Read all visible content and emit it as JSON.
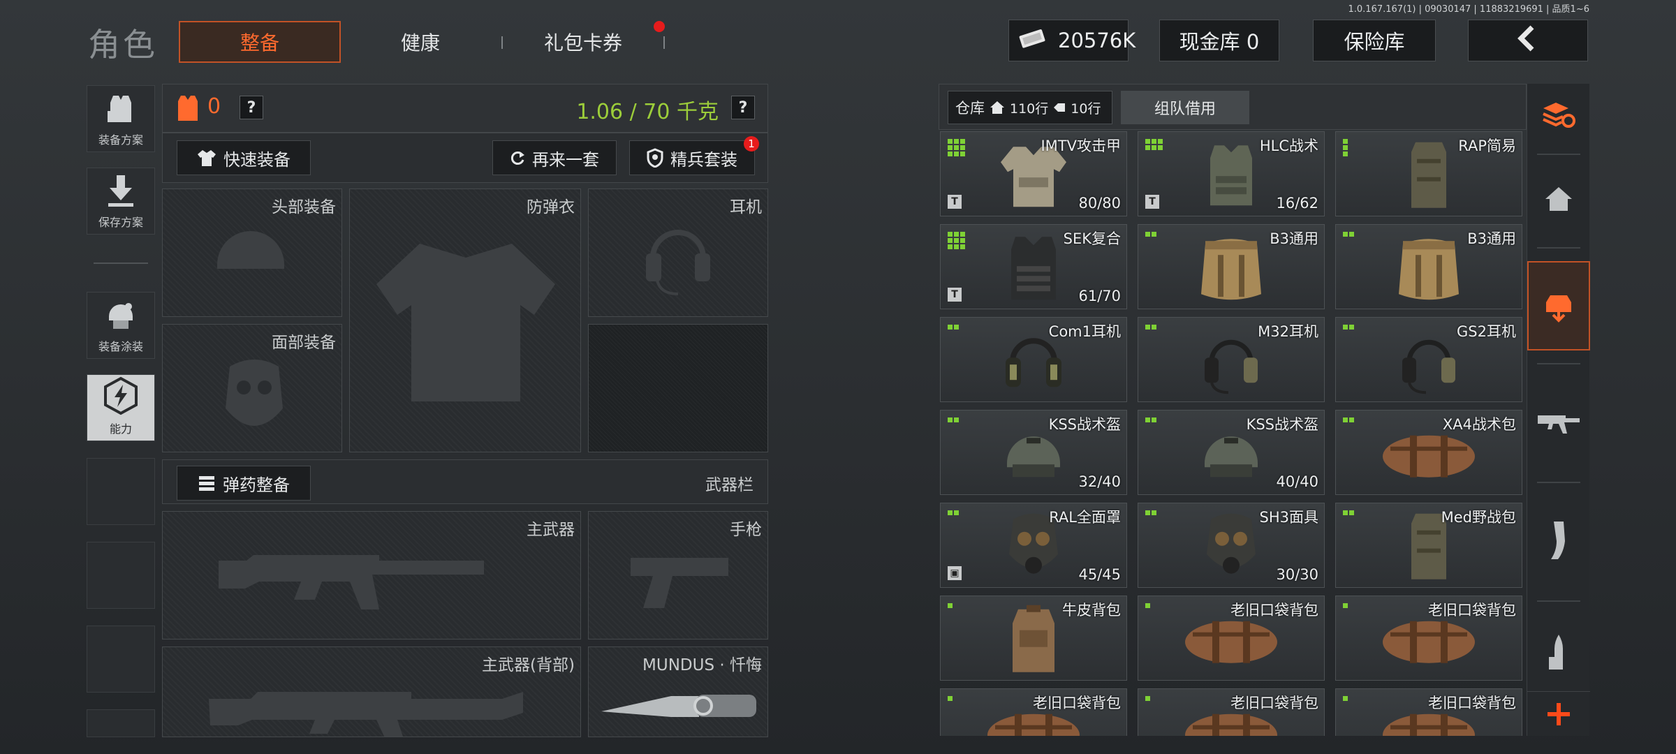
{
  "version": "1.0.167.167(1) | 09030147 | 11883219691 | 品质1~6",
  "header": {
    "title": "角色",
    "tabs": [
      {
        "label": "整备",
        "active": true
      },
      {
        "label": "健康",
        "active": false
      },
      {
        "label": "礼包卡券",
        "active": false,
        "has_badge": true
      }
    ],
    "money": "20576K",
    "cash_vault": "现金库 0",
    "safe_vault": "保险库"
  },
  "left_nav": [
    {
      "label": "装备方案",
      "icon": "vest-icon"
    },
    {
      "label": "保存方案",
      "icon": "download-icon"
    },
    {
      "label": "装备涂装",
      "icon": "helmet-paint-icon"
    },
    {
      "label": "能力",
      "icon": "lightning-icon",
      "active": true
    }
  ],
  "loadout": {
    "armor_count": "0",
    "weight": "1.06 / 70 千克",
    "quick_equip": "快速装备",
    "again": "再来一套",
    "elite_set": "精兵套装",
    "elite_badge": "1",
    "slots": {
      "head": "头部装备",
      "body": "防弹衣",
      "ear": "耳机",
      "face": "面部装备"
    },
    "ammo_btn": "弹药整备",
    "weapon_bar": "武器栏",
    "weapons": {
      "primary": "主武器",
      "pistol": "手枪",
      "primary_back": "主武器(背部)",
      "melee": "MUNDUS · 忏悔"
    }
  },
  "storage": {
    "tab_label": "仓库",
    "rows_home": "110行",
    "rows_tag": "10行",
    "team_borrow": "组队借用",
    "items": [
      {
        "name": "IMTV攻击甲",
        "count": "80/80",
        "dots": 9,
        "icon": "vest-armor-icon",
        "corner": "T"
      },
      {
        "name": "HLC战术",
        "count": "16/62",
        "dots": 6,
        "icon": "plate-carrier-icon",
        "corner": "T"
      },
      {
        "name": "RAP简易",
        "count": "",
        "dots": 3,
        "icon": "pouch-icon",
        "corner": ""
      },
      {
        "name": "SEK复合",
        "count": "61/70",
        "dots": 9,
        "icon": "tactical-vest-icon",
        "corner": "T"
      },
      {
        "name": "B3通用",
        "count": "",
        "dots": 2,
        "icon": "sack-bag-icon",
        "corner": ""
      },
      {
        "name": "B3通用",
        "count": "",
        "dots": 2,
        "icon": "sack-bag-icon",
        "corner": ""
      },
      {
        "name": "Com1耳机",
        "count": "",
        "dots": 2,
        "icon": "earmuff-icon",
        "corner": ""
      },
      {
        "name": "M32耳机",
        "count": "",
        "dots": 2,
        "icon": "headset-icon",
        "corner": ""
      },
      {
        "name": "GS2耳机",
        "count": "",
        "dots": 2,
        "icon": "headset-icon",
        "corner": ""
      },
      {
        "name": "KSS战术盔",
        "count": "32/40",
        "dots": 2,
        "icon": "helmet-icon",
        "corner": ""
      },
      {
        "name": "KSS战术盔",
        "count": "40/40",
        "dots": 2,
        "icon": "helmet-icon",
        "corner": ""
      },
      {
        "name": "XA4战术包",
        "count": "",
        "dots": 2,
        "icon": "duffel-icon",
        "corner": ""
      },
      {
        "name": "RAL全面罩",
        "count": "45/45",
        "dots": 2,
        "icon": "gas-mask-icon",
        "corner": "box"
      },
      {
        "name": "SH3面具",
        "count": "30/30",
        "dots": 2,
        "icon": "gas-mask-icon",
        "corner": ""
      },
      {
        "name": "Med野战包",
        "count": "",
        "dots": 2,
        "icon": "pouch-icon",
        "corner": ""
      },
      {
        "name": "牛皮背包",
        "count": "",
        "dots": 1,
        "icon": "backpack-icon",
        "corner": ""
      },
      {
        "name": "老旧口袋背包",
        "count": "",
        "dots": 1,
        "icon": "duffel-icon",
        "corner": ""
      },
      {
        "name": "老旧口袋背包",
        "count": "",
        "dots": 1,
        "icon": "duffel-icon",
        "corner": ""
      },
      {
        "name": "老旧口袋背包",
        "count": "",
        "dots": 1,
        "icon": "duffel-icon",
        "corner": ""
      },
      {
        "name": "老旧口袋背包",
        "count": "",
        "dots": 1,
        "icon": "duffel-icon",
        "corner": ""
      },
      {
        "name": "老旧口袋背包",
        "count": "",
        "dots": 1,
        "icon": "duffel-icon",
        "corner": ""
      }
    ]
  },
  "right_nav": [
    "refresh-stack-icon",
    "home-icon",
    "backpack-sort-icon",
    "rifle-icon",
    "magazine-icon",
    "bullet-icon",
    "plus-icon"
  ],
  "colors": {
    "accent": "#c25226",
    "active_text": "#ff6a2e",
    "weight_green": "#9ccd3a",
    "dot_green": "#7fd135"
  }
}
